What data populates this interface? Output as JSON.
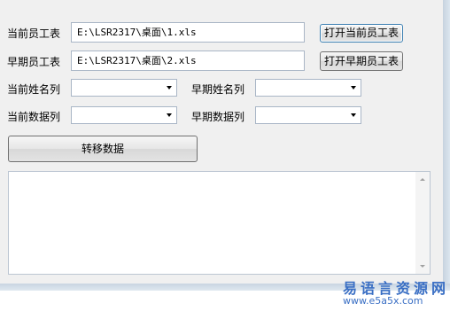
{
  "form": {
    "current_sheet_label": "当前员工表",
    "current_sheet_path": "E:\\LSR2317\\桌面\\1.xls",
    "open_current_button": "打开当前员工表",
    "previous_sheet_label": "早期员工表",
    "previous_sheet_path": "E:\\LSR2317\\桌面\\2.xls",
    "open_previous_button": "打开早期员工表",
    "current_name_col_label": "当前姓名列",
    "current_name_col_value": "",
    "previous_name_col_label": "早期姓名列",
    "previous_name_col_value": "",
    "current_data_col_label": "当前数据列",
    "current_data_col_value": "",
    "previous_data_col_label": "早期数据列",
    "previous_data_col_value": "",
    "transfer_button": "转移数据",
    "log_text": ""
  },
  "watermark": {
    "name": "易语言资源网",
    "url": "www.e5a5x.com"
  },
  "icons": {
    "combo_arrow": "chevron-down-icon",
    "scroll_up": "scroll-up-icon",
    "scroll_down": "scroll-down-icon"
  }
}
